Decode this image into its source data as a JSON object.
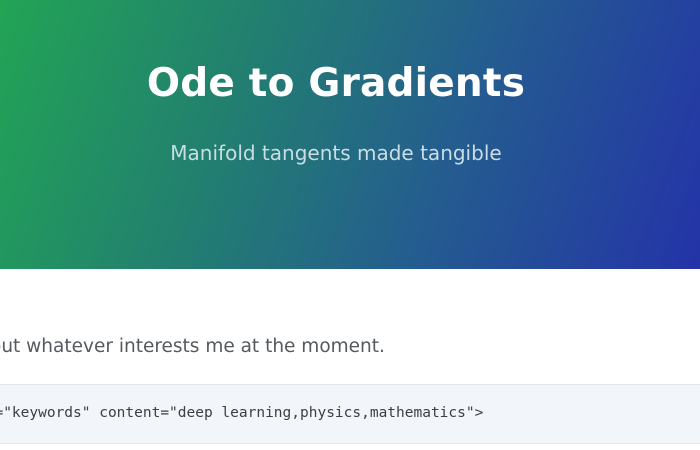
{
  "hero": {
    "title": "Ode to Gradients",
    "subtitle": "Manifold tangents made tangible"
  },
  "content": {
    "intro_text": "out whatever interests me at the moment.",
    "code_line": "me=\"keywords\" content=\"deep learning,physics,mathematics\">"
  },
  "colors": {
    "hero_gradient_start": "#22a455",
    "hero_gradient_end": "#2433a8",
    "hero_title": "#ffffff",
    "hero_subtitle": "#c9dde4",
    "body_text": "#555a5f",
    "code_background": "#f2f5f9"
  }
}
